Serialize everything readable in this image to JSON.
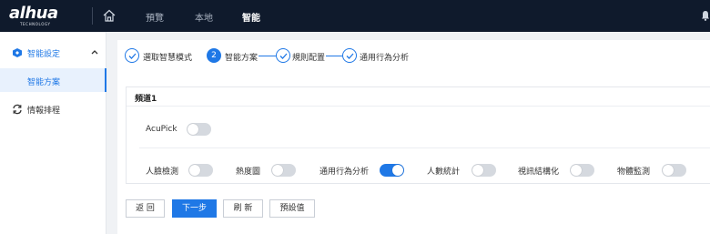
{
  "brand": {
    "logo_text": "alhua",
    "logo_sub": "TECHNOLOGY"
  },
  "topnav": {
    "items": [
      {
        "label": "預覽",
        "active": false
      },
      {
        "label": "本地",
        "active": false
      },
      {
        "label": "智能",
        "active": true
      }
    ]
  },
  "sidebar": {
    "group_label": "智能設定",
    "sub_label": "智能方案",
    "item_label": "情報排程"
  },
  "steps": [
    {
      "label": "選取智慧模式",
      "state": "done"
    },
    {
      "label": "智能方案",
      "state": "active",
      "number": "2"
    },
    {
      "label": "規則配置",
      "state": "done"
    },
    {
      "label": "通用行為分析",
      "state": "done"
    }
  ],
  "card": {
    "title": "頻道1",
    "acupick_label": "AcuPick",
    "acupick_on": false,
    "features": [
      {
        "label": "人臉檢測",
        "on": false
      },
      {
        "label": "熱度圖",
        "on": false
      },
      {
        "label": "通用行為分析",
        "on": true
      },
      {
        "label": "人數統計",
        "on": false
      },
      {
        "label": "視訊結構化",
        "on": false
      },
      {
        "label": "物體監測",
        "on": false
      }
    ]
  },
  "buttons": {
    "back": "返 回",
    "next": "下一步",
    "refresh": "刷 新",
    "default": "預設值"
  },
  "colors": {
    "accent": "#1f78e6",
    "topbar": "#0f1a2c",
    "toggle_off": "#d5d9df"
  }
}
